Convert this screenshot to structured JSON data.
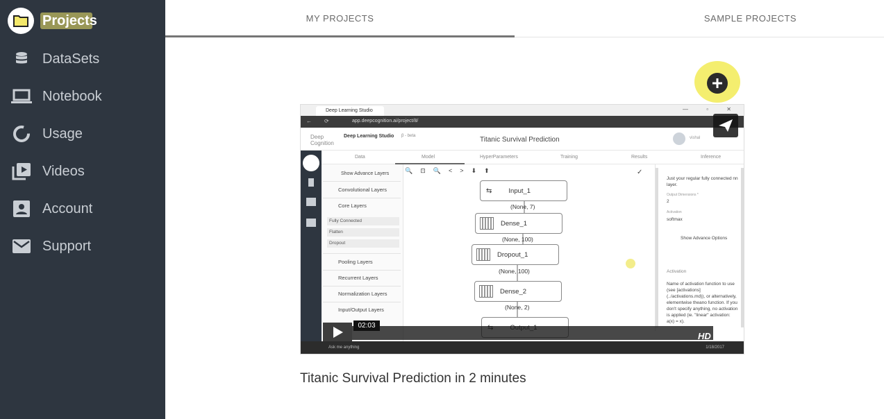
{
  "sidebar": {
    "items": [
      {
        "label": "Projects",
        "icon": "folder-icon",
        "active": true
      },
      {
        "label": "DataSets",
        "icon": "database-icon",
        "active": false
      },
      {
        "label": "Notebook",
        "icon": "laptop-icon",
        "active": false
      },
      {
        "label": "Usage",
        "icon": "donut-chart-icon",
        "active": false
      },
      {
        "label": "Videos",
        "icon": "video-library-icon",
        "active": false
      },
      {
        "label": "Account",
        "icon": "account-box-icon",
        "active": false
      },
      {
        "label": "Support",
        "icon": "mail-icon",
        "active": false
      }
    ]
  },
  "tabs": {
    "my_projects": "MY PROJECTS",
    "sample_projects": "SAMPLE PROJECTS"
  },
  "video": {
    "title": "Titanic Survival Prediction in 2 minutes",
    "timestamp": "02:03",
    "hd_label": "HD",
    "browser_tab": "Deep Learning Studio",
    "url": "app.deepcognition.ai/project/8/",
    "brand": "Deep Learning Studio",
    "brand_badge": "β - beta",
    "logo_text": "Deep Cognition",
    "app_title": "Titanic Survival Prediction",
    "user": "vishal",
    "nav_tabs": [
      "Data",
      "Model",
      "HyperParameters",
      "Training",
      "Results",
      "Inference"
    ],
    "show_advance_layers": "Show Advance Layers",
    "layer_groups": [
      "Convolutional Layers",
      "Core Layers",
      "Pooling Layers",
      "Recurrent Layers",
      "Normalization Layers",
      "Input/Output Layers"
    ],
    "core_layers": [
      "Fully Connected",
      "Flatten",
      "Dropout"
    ],
    "nodes": [
      "Input_1",
      "Dense_1",
      "Dropout_1",
      "Dense_2",
      "Output_1"
    ],
    "shapes": [
      "(None, 7)",
      "(None, 100)",
      "(None, 100)",
      "(None, 2)"
    ],
    "right_panel": {
      "desc": "Just your regular fully connected nn layer.",
      "output_dim_label": "Output Dimensions *",
      "output_dim_value": "2",
      "activation_label": "Activation",
      "activation_value": "softmax",
      "show_advance_options": "Show Advance Options",
      "activation_heading": "Activation",
      "activation_help": "Name of activation function to use (see [activations] (../activations.md)), or alternatively, elementwise theano function. If you don't specify anything, no activation is applied (ie. \"linear\" activation: a(x) = x)."
    },
    "taskbar_search": "Ask me anything",
    "taskbar_date": "1/18/2017"
  },
  "colors": {
    "sidebar_bg": "#2e3640",
    "highlight": "#f4ee6f",
    "tab_indicator": "#757575"
  }
}
